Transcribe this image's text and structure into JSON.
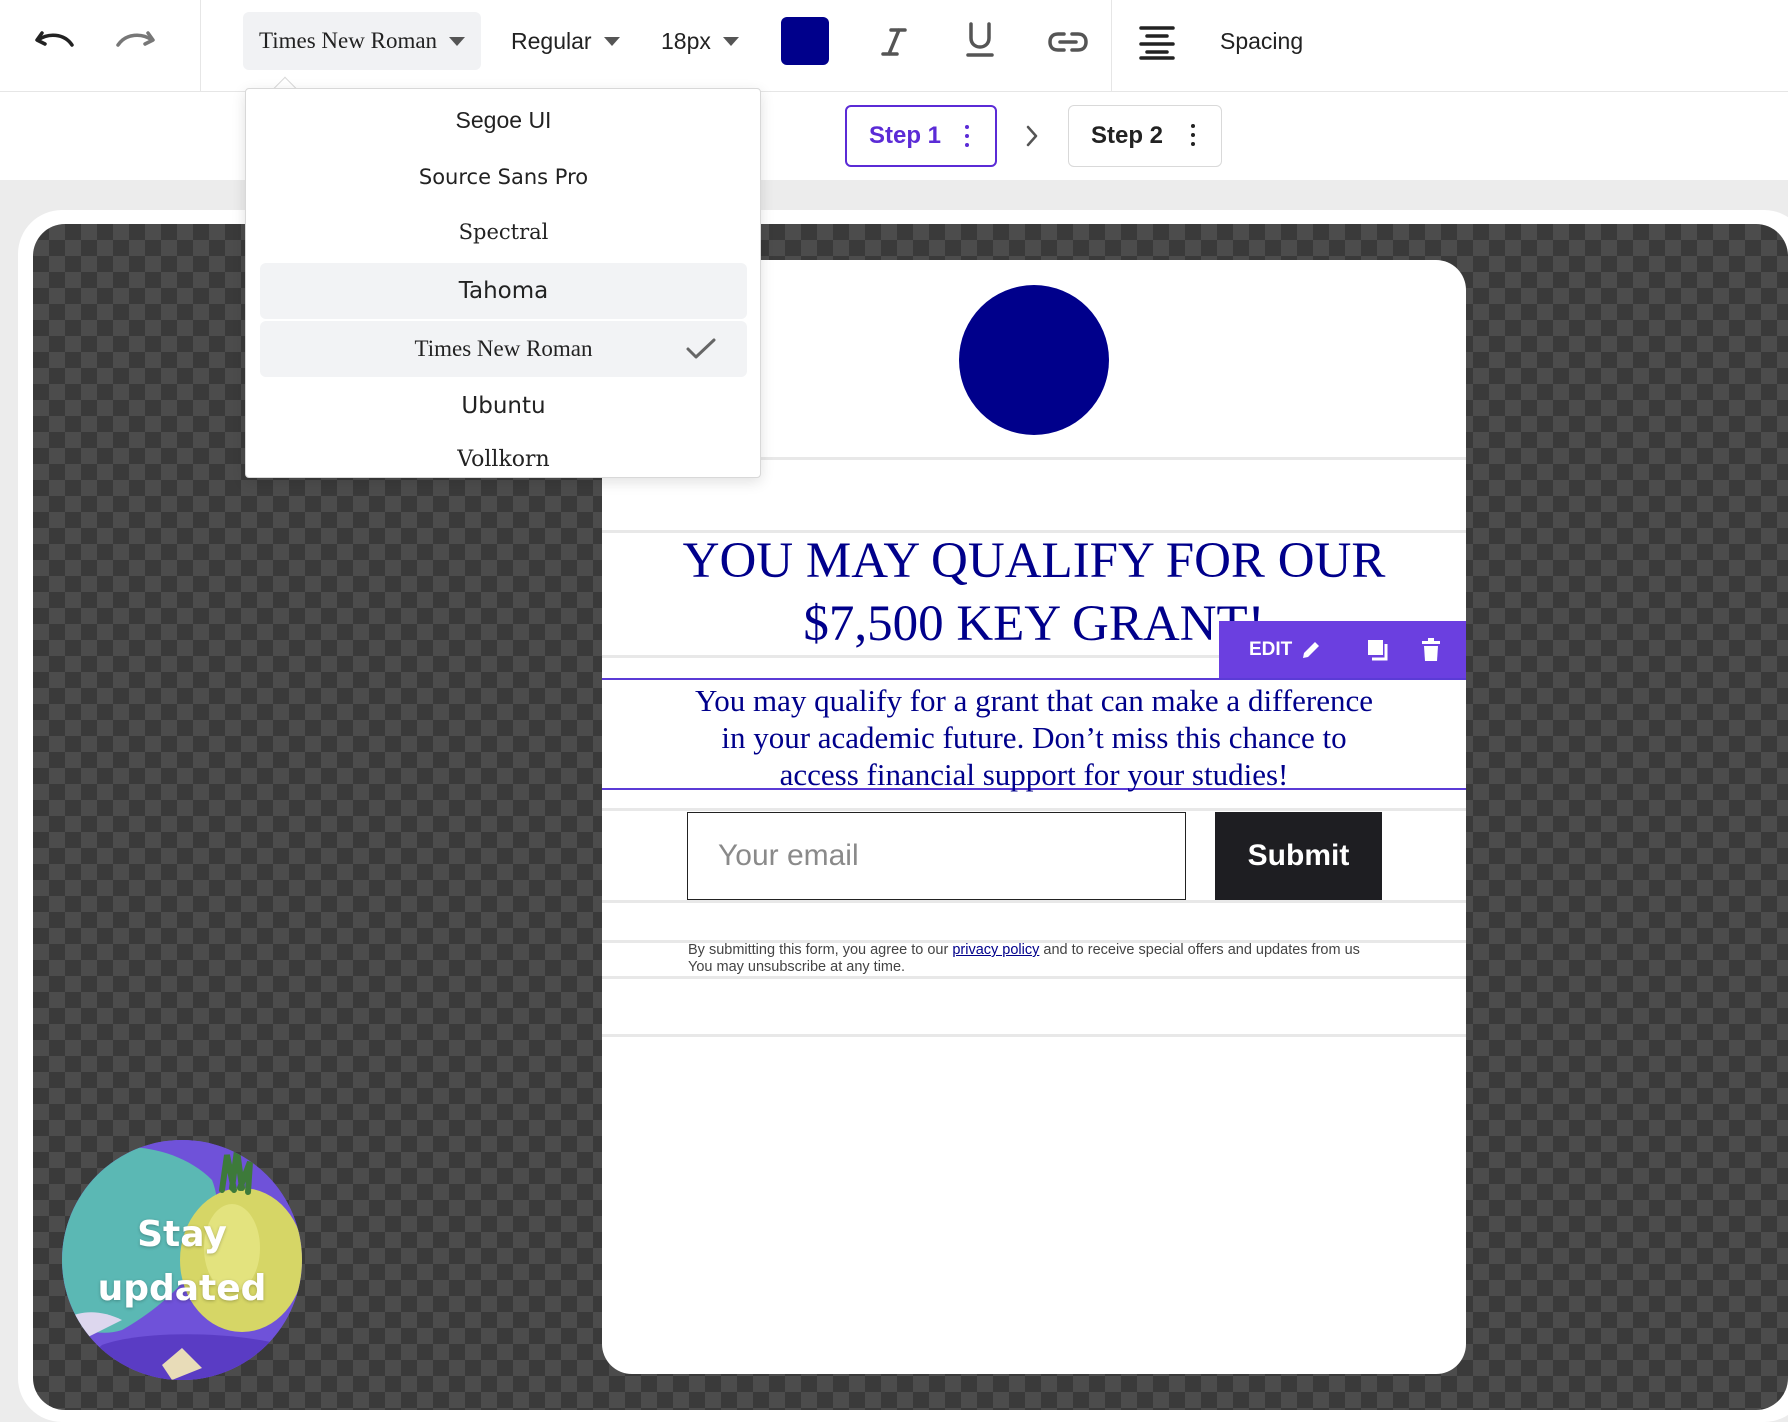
{
  "toolbar": {
    "font_family": "Times New Roman",
    "font_weight": "Regular",
    "font_size": "18px",
    "text_color": "#00008b",
    "spacing_label": "Spacing",
    "icons": [
      "undo-icon",
      "redo-icon",
      "italic-icon",
      "underline-icon",
      "link-icon",
      "align-center-icon"
    ]
  },
  "steps": [
    {
      "label": "Step 1",
      "active": true
    },
    {
      "label": "Step 2",
      "active": false
    }
  ],
  "font_menu": {
    "items": [
      {
        "label": "Segoe UI"
      },
      {
        "label": "Source Sans Pro"
      },
      {
        "label": "Spectral"
      },
      {
        "label": "Tahoma"
      },
      {
        "label": "Times New Roman"
      },
      {
        "label": "Ubuntu"
      },
      {
        "label": "Vollkorn"
      }
    ],
    "selected": "Times New Roman",
    "hovered": "Tahoma"
  },
  "popup": {
    "headline": "YOU MAY QUALIFY FOR OUR $7,500 KEY GRANT!",
    "body": "You may qualify for a grant that can make a difference in your academic future. Don’t miss this chance to access financial support for your studies!",
    "email_placeholder": "Your email",
    "submit_label": "Submit",
    "disclaimer_pre": "By submitting this form, you agree to our ",
    "disclaimer_link": "privacy policy",
    "disclaimer_post": " and to receive special offers and updates from us You may unsubscribe at any time.",
    "brand_color": "#00008b"
  },
  "edit_bar": {
    "edit_label": "EDIT",
    "accent": "#6b3fe0"
  },
  "teaser": {
    "label_line1": "Stay",
    "label_line2": "updated"
  }
}
